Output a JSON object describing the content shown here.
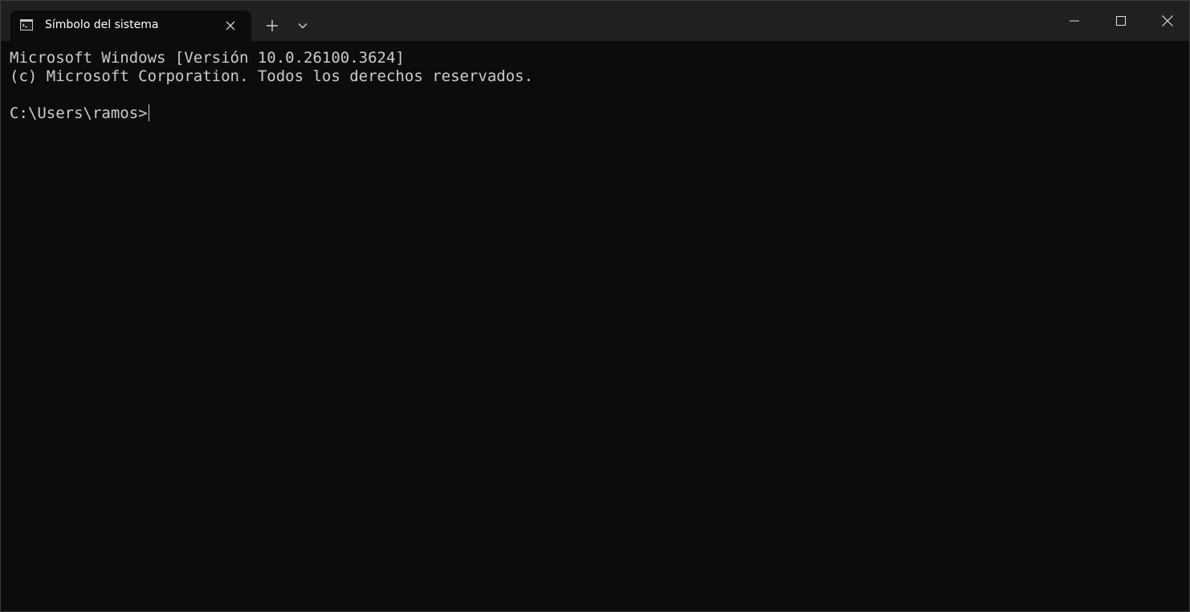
{
  "window": {
    "tab": {
      "title": "Símbolo del sistema",
      "icon": "command-prompt-icon"
    },
    "controls": {
      "new_tab_icon": "plus-icon",
      "dropdown_icon": "chevron-down-icon",
      "minimize_icon": "minimize-icon",
      "maximize_icon": "maximize-icon",
      "close_icon": "close-icon"
    }
  },
  "terminal": {
    "lines": [
      "Microsoft Windows [Versión 10.0.26100.3624]",
      "(c) Microsoft Corporation. Todos los derechos reservados.",
      ""
    ],
    "prompt": "C:\\Users\\ramos>"
  },
  "colors": {
    "titlebar": "#202020",
    "terminal_bg": "#0c0c0c",
    "terminal_text": "#cccccc",
    "tab_text": "#ffffff"
  }
}
